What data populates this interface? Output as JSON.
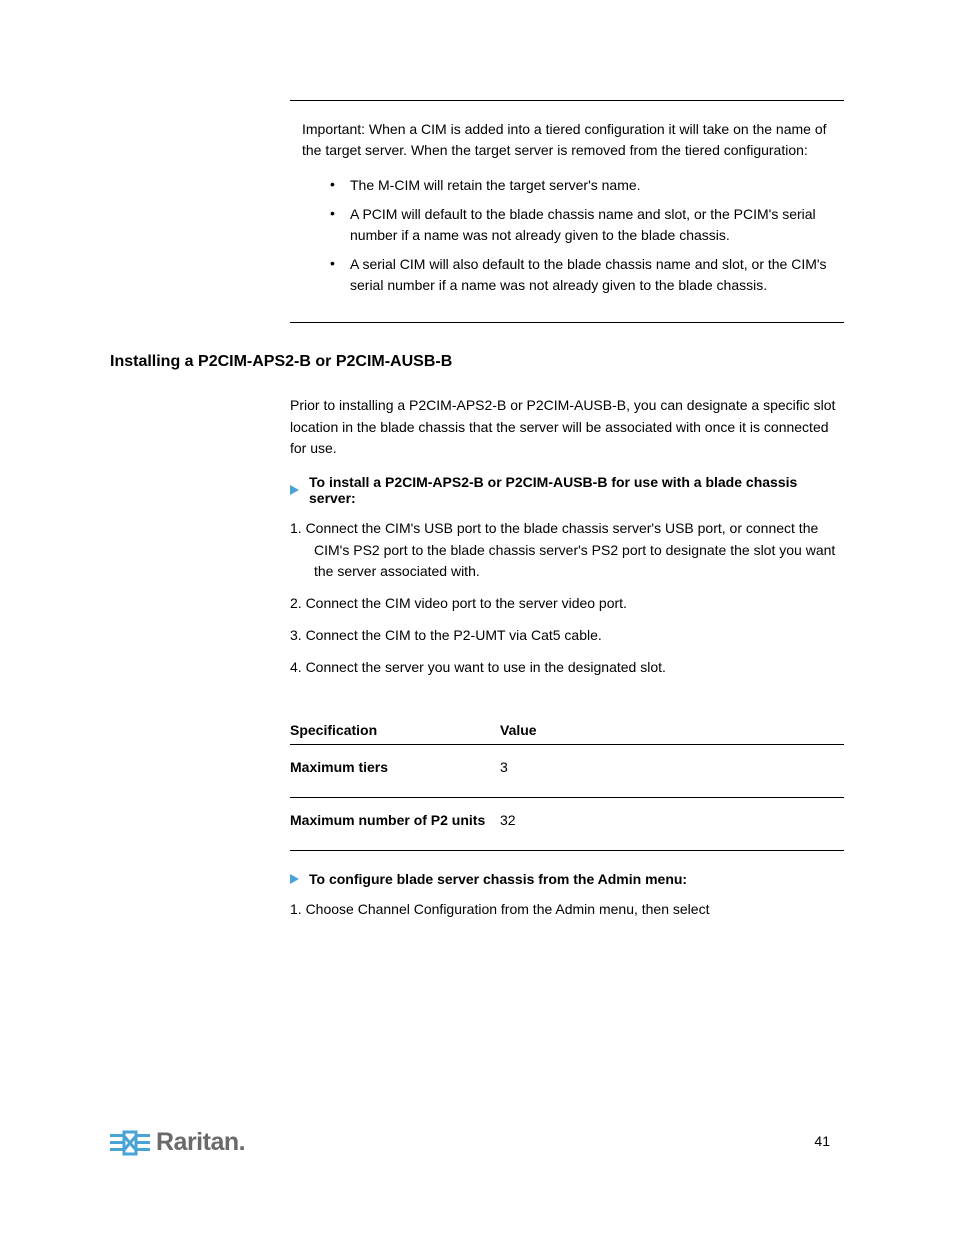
{
  "graybox": {
    "intro": "Important: When a CIM is added into a tiered configuration it will take on the name of the target server. When the target server is removed from the tiered configuration:",
    "items": [
      "The M-CIM will retain the target server's name.",
      "A PCIM will default to the blade chassis name and slot, or the PCIM's serial number if a name was not already given to the blade chassis.",
      "A serial CIM will also default to the blade chassis name and slot, or the CIM's serial number if a name was not already given to the blade chassis."
    ]
  },
  "section_title": "Installing a P2CIM-APS2-B or P2CIM-AUSB-B",
  "para1": "Prior to installing a P2CIM-APS2-B or P2CIM-AUSB-B, you can designate a specific slot location in the blade chassis that the server will be associated with once it is connected for use.",
  "proc1": {
    "label": "To install a P2CIM-APS2-B or P2CIM-AUSB-B for use with a blade chassis server:",
    "steps": [
      "1.  Connect the CIM's USB port to the blade chassis server's USB port, or connect the CIM's PS2 port to the blade chassis server's PS2 port to designate the slot you want the server associated with.",
      "2.  Connect the CIM video port to the server video port.",
      "3.  Connect the CIM to the P2-UMT via Cat5 cable.",
      "4.  Connect the server you want to use in the designated slot."
    ]
  },
  "spec": {
    "h1": "Specification",
    "h2": "Value",
    "r1c1": "Maximum tiers",
    "r1c2": "3",
    "r2c1": "Maximum number of P2 units",
    "r2c2": "32"
  },
  "proc2": {
    "label": "To configure blade server chassis from the Admin menu:",
    "steps": [
      "1.  Choose Channel Configuration from the Admin menu, then select"
    ]
  },
  "page_number": "41"
}
